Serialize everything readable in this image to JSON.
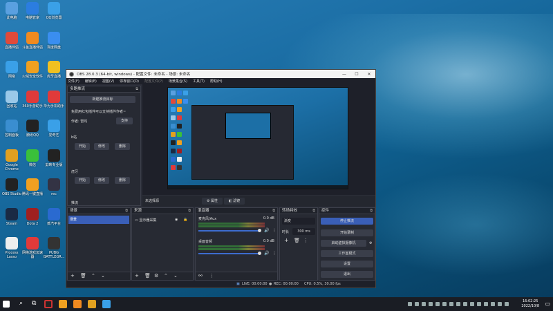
{
  "desktop": {
    "icons": [
      {
        "label": "此电脑",
        "color": "#5aa0e0"
      },
      {
        "label": "电脑管家",
        "color": "#2b7de0"
      },
      {
        "label": "QQ浏览器",
        "color": "#3aa0e8"
      },
      {
        "label": "直播伴侣",
        "color": "#e04a3a"
      },
      {
        "label": "斗鱼直播伴侣",
        "color": "#f08a20"
      },
      {
        "label": "百度网盘",
        "color": "#3a8ef0"
      },
      {
        "label": "网络",
        "color": "#3aa0e8"
      },
      {
        "label": "火绒安全软件",
        "color": "#f0a020"
      },
      {
        "label": "虎牙直播",
        "color": "#f0c020"
      },
      {
        "label": "回收站",
        "color": "#9ac8e8"
      },
      {
        "label": "360手游助手",
        "color": "#e03a3a"
      },
      {
        "label": "华为手机助手",
        "color": "#e03a3a"
      },
      {
        "label": "控制面板",
        "color": "#3a8ed0"
      },
      {
        "label": "腾讯QQ",
        "color": "#222"
      },
      {
        "label": "爱奇艺",
        "color": "#3aa0e8"
      },
      {
        "label": "Google Chrome",
        "color": "#e0a020"
      },
      {
        "label": "微信",
        "color": "#3ac03a"
      },
      {
        "label": "剪映专业版",
        "color": "#222"
      },
      {
        "label": "OBS Studio",
        "color": "#222"
      },
      {
        "label": "腾讯一键直播",
        "color": "#f0a020"
      },
      {
        "label": "rec",
        "color": "#334"
      },
      {
        "label": "Steam",
        "color": "#1a2a44"
      },
      {
        "label": "Dota 2",
        "color": "#a02020"
      },
      {
        "label": "蒸汽平台",
        "color": "#2a6ad0"
      },
      {
        "label": "Process Lasso",
        "color": "#eee"
      },
      {
        "label": "网络游戏加速器",
        "color": "#e03a3a"
      },
      {
        "label": "PUBG BATTLEGR...",
        "color": "#333"
      }
    ]
  },
  "obs": {
    "title": "OBS 28.0.3 (64-bit, windows) - 配置文件: 未命名 - 场景: 未命名",
    "min_icon": "—",
    "max_icon": "☐",
    "close_icon": "✕",
    "menu": [
      "文件(F)",
      "编辑(E)",
      "视图(V)",
      "停靠窗口(D)",
      "配置文件(P)",
      "场景集合(S)",
      "工具(T)",
      "帮助(H)"
    ],
    "auto_panel": {
      "title": "多路推流",
      "btn_new": "新建推流目标",
      "info": "免费用红包插件可以支持插件作者~",
      "author": "作者: 雷鸣",
      "support": "支持",
      "section1": "b站",
      "section2": "虎牙",
      "start": "开始",
      "edit": "修改",
      "delete": "删除"
    },
    "preview_tools": {
      "label": "未选择源",
      "props": "属性",
      "filters": "滤镜"
    },
    "dock_label": "推流",
    "scenes": {
      "title": "场景",
      "items": [
        "场景"
      ]
    },
    "sources": {
      "title": "来源",
      "items": [
        "显示器采集"
      ]
    },
    "mixer": {
      "title": "混音器",
      "channels": [
        {
          "name": "麦克风/Aux",
          "db": "0.0 dB"
        },
        {
          "name": "桌面音频",
          "db": "0.0 dB"
        }
      ]
    },
    "transitions": {
      "title": "转场特效",
      "type": "渐变",
      "duration_label": "时长",
      "duration": "300 ms"
    },
    "controls": {
      "title": "控件",
      "buttons": [
        "停止推流",
        "开始录制",
        "启动虚拟摄像机",
        "工作室模式",
        "设置",
        "退出"
      ]
    },
    "status": {
      "live": "LIVE: 00:00:00",
      "rec": "REC: 00:00:00",
      "cpu": "CPU: 0.5%, 30.00 fps"
    }
  },
  "taskbar": {
    "time": "16:02:25",
    "date": "2022/10/8"
  },
  "colors": {
    "accent": "#3a5fb8",
    "obs_bg": "#2b2e38"
  }
}
